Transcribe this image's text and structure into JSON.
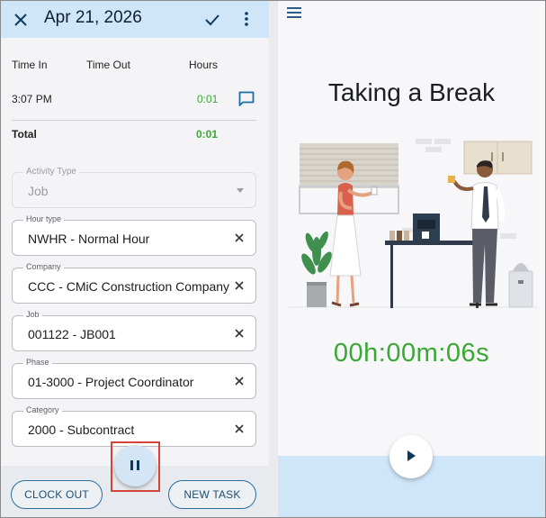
{
  "left_panel": {
    "header": {
      "date": "Apr 21, 2026",
      "close_icon": "close-icon",
      "save_icon": "check-icon",
      "menu_icon": "more-vert-icon"
    },
    "time_table": {
      "columns": [
        "Time In",
        "Time Out",
        "Hours"
      ],
      "rows": [
        {
          "time_in": "3:07 PM",
          "time_out": "",
          "hours": "0:01",
          "icon": "comment-icon"
        }
      ],
      "total_label": "Total",
      "total_hours": "0:01"
    },
    "fields": {
      "activity_type": {
        "label": "Activity Type",
        "value": "Job"
      },
      "hour_type": {
        "label": "Hour type",
        "value": "NWHR - Normal Hour"
      },
      "company": {
        "label": "Company",
        "value": "CCC - CMiC Construction Company"
      },
      "job": {
        "label": "Job",
        "value": "001122 - JB001"
      },
      "phase": {
        "label": "Phase",
        "value": "01-3000 - Project Coordinator"
      },
      "category": {
        "label": "Category",
        "value": "2000 - Subcontract"
      }
    },
    "footer": {
      "clock_out": "CLOCK OUT",
      "new_task": "NEW TASK",
      "pause_icon": "pause-icon"
    }
  },
  "right_panel": {
    "menu_icon": "hamburger-menu-icon",
    "title": "Taking a Break",
    "timer": "00h:00m:06s",
    "play_icon": "play-icon"
  },
  "colors": {
    "accent_blue": "#cfe5f8",
    "green": "#3aa835",
    "navy": "#0d3a5c",
    "highlight_red": "#d3453a"
  }
}
